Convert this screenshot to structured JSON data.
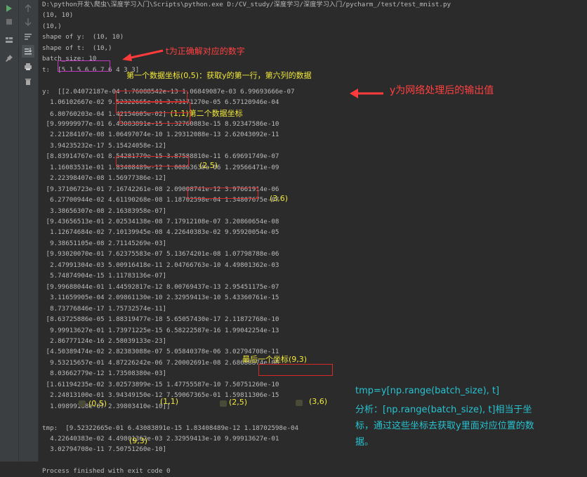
{
  "console": {
    "lines": [
      "D:\\python开发\\爬虫\\深度学习入门\\Scripts\\python.exe D:/CV_study/深度学习/深度学习入门/pycharm_/test/test_mnist.py",
      "(10, 10)",
      "(10,)",
      "shape of y:  (10, 10)",
      "shape of t:  (10,)",
      "batch_size: 10",
      "t:  [5 1 5 6 6 7 6 4 3 3]",
      "",
      "y:  [[2.04072187e-04 1.76088542e-13 1.06849087e-03 6.99693666e-07",
      "  1.06102667e-02 9.52322665e-01 3.73171270e-05 6.57120946e-04",
      "  6.80760203e-04 1.42154605e-02] (1,1)第二个数据坐标",
      " [9.99999977e-01 6.43083891e-15 1.32760883e-15 8.92347586e-10",
      "  2.21284107e-08 1.06497074e-10 1.29312088e-13 2.62043092e-11",
      "  3.94235232e-17 5.15424058e-12]",
      " [8.83914767e-01 8.54281779e-15 3.87588810e-11 6.69691749e-07",
      "  1.16083531e-01 1.83408489e-12 1.00863630e-06 1.29566471e-09",
      "  2.22398407e-08 1.56977386e-12]",
      " [9.37106723e-01 7.16742261e-08 2.09008741e-12 3.97661914e-06",
      "  6.27700944e-02 4.61190268e-08 1.18702598e-04 1.34807675e-07",
      "  3.38656307e-08 2.16383958e-07]",
      " [9.43656513e-01 2.02534138e-08 7.17912108e-07 3.20860654e-08",
      "  1.12674684e-02 7.10139945e-08 4.22640383e-02 9.95920054e-05",
      "  9.38651105e-08 2.71145269e-03]",
      " [9.93020070e-01 7.62375583e-07 5.13674201e-08 1.07798788e-06",
      "  2.47991304e-03 5.00916418e-11 2.04766763e-10 4.49801362e-03",
      "  5.74874904e-15 1.11783136e-07]",
      " [9.99688044e-01 1.44592817e-12 8.00769437e-13 2.95451175e-07",
      "  3.11659905e-04 2.09861130e-10 2.32959413e-10 5.43360761e-15",
      "  8.73776846e-17 1.75732574e-11]",
      " [8.63725886e-05 1.88319477e-18 5.65057430e-17 2.11872768e-10",
      "  9.99913627e-01 1.73971225e-15 6.58222587e-16 1.99042254e-13",
      "  2.86777124e-16 2.58039133e-23]",
      " [4.50389474e-02 2.82383088e-07 5.05840378e-06 3.02794708e-11",
      "  9.53215657e-01 4.87226242e-06 7.20002691e-08 2.68688874e-08",
      "  8.03662779e-12 1.73508380e-03]",
      " [1.61194235e-02 3.02573899e-15 1.47755587e-10 7.50751260e-10",
      "  2.24813100e-01 3.94349150e-12 7.59067365e-01 1.59811306e-15",
      "  1.09899168e-07 2.39803410e-10]]",
      "",
      "tmp:  [9.52322665e-01 6.43083891e-15 1.83408489e-12 1.18702598e-04",
      "  4.22640383e-02 4.49801362e-03 2.32959413e-10 9.99913627e-01",
      "  3.02794708e-11 7.50751260e-10]",
      "",
      "Process finished with exit code 0"
    ]
  },
  "annotations": {
    "t_note": "t为正确解对应的数字",
    "first_coord": "第一个数据坐标(0,5)：获取y的第一行，第六列的数据",
    "y_note": "y为网络处理后的输出值",
    "c25": "(2,5)",
    "c36": "(3,6)",
    "last_coord": "最后一个坐标(9,3)",
    "b05": "(0,5)",
    "b11": "(1,1)",
    "b25": "(2,5)",
    "b36": "(3,6)",
    "b93": "(9,3)",
    "explain1": "tmp=y[np.range(batch_size), t]",
    "explain2": "分析：[np.range(batch_size), t]相当于坐",
    "explain3": "标，通过这些坐标去获取y里面对应位置的数",
    "explain4": "据。"
  },
  "toolbar": {
    "left": [
      "run-icon",
      "stop-icon",
      "rerun-icon",
      "layout-icon",
      "pin-icon"
    ],
    "right": [
      "up-arrow-icon",
      "down-arrow-icon",
      "soft-wrap-icon",
      "scroll-to-end-icon",
      "print-icon",
      "trash-icon"
    ]
  },
  "colors": {
    "background": "#2b2b2b",
    "text": "#bbbbbb",
    "highlight_box": "#d42a2a",
    "annotation_yellow": "#f2e93a",
    "annotation_red": "#ff4141",
    "annotation_cyan": "#27c3d1"
  }
}
